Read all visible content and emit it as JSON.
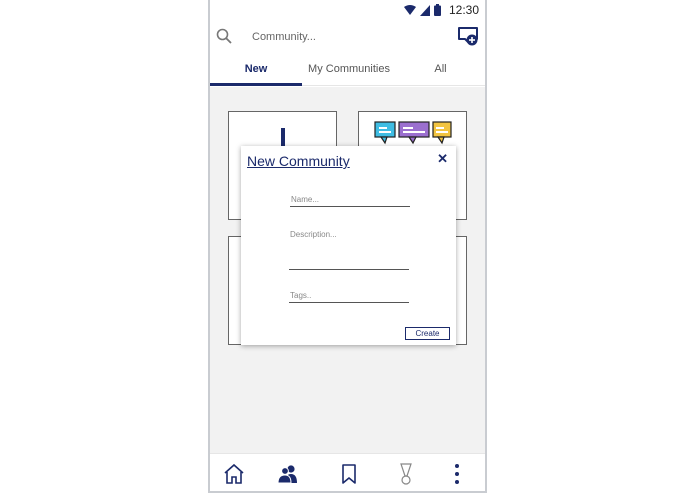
{
  "status_bar": {
    "time": "12:30",
    "icons": [
      "wifi-icon",
      "signal-icon",
      "battery-icon"
    ]
  },
  "app_bar": {
    "search_placeholder": "Community...",
    "search_icon": "search-icon",
    "add_community_icon": "add-community-icon"
  },
  "tabs": [
    {
      "label": "New",
      "active": true
    },
    {
      "label": "My Communities",
      "active": false
    },
    {
      "label": "All",
      "active": false
    }
  ],
  "dialog": {
    "title": "New Community",
    "close_label": "✕",
    "name_placeholder": "Name...",
    "description_placeholder": "Description...",
    "tags_placeholder": "Tags..",
    "create_label": "Create"
  },
  "bottom_nav": {
    "items": [
      "home-icon",
      "community-icon",
      "bookmark-icon",
      "badge-icon",
      "more-icon"
    ],
    "active": "community-icon"
  },
  "colors": {
    "accent": "#1b2a6b",
    "chat_blue": "#3fbde3",
    "chat_purple": "#9b6fcf",
    "chat_yellow": "#f2c441"
  }
}
